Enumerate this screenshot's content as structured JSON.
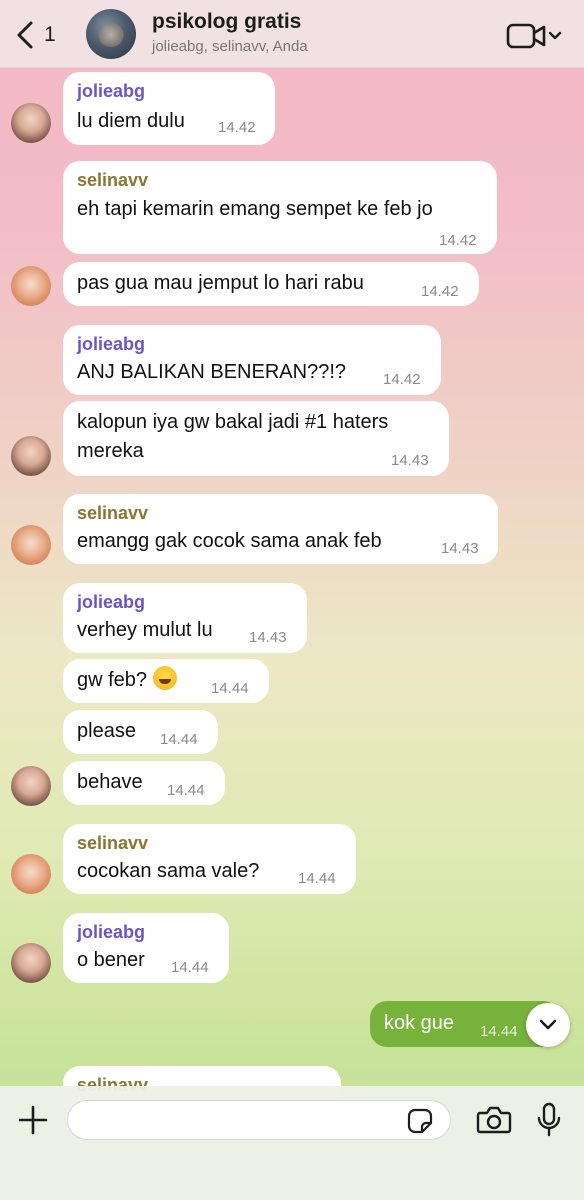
{
  "header": {
    "back_count": "1",
    "group_name": "psikolog gratis",
    "members": "jolieabg, selinavv, Anda"
  },
  "messages": [
    {
      "sender": "jolieabg",
      "text": "lu diem dulu",
      "time": "14.42"
    },
    {
      "sender": "selinavv",
      "text": "eh tapi kemarin emang sempet ke feb jo",
      "time": "14.42"
    },
    {
      "sender": "",
      "text": "pas gua mau jemput lo hari rabu",
      "time": "14.42"
    },
    {
      "sender": "jolieabg",
      "text": "ANJ BALIKAN BENERAN??!?",
      "time": "14.42"
    },
    {
      "sender": "",
      "text_line1": "kalopun iya gw bakal jadi #1 haters",
      "text_line2": "mereka",
      "time": "14.43"
    },
    {
      "sender": "selinavv",
      "text": "emangg gak cocok sama anak feb",
      "time": "14.43"
    },
    {
      "sender": "jolieabg",
      "text": "verhey mulut lu",
      "time": "14.43"
    },
    {
      "sender": "",
      "text": "gw feb?",
      "emoji": "grinning-sweat-emoji",
      "time": "14.44"
    },
    {
      "sender": "",
      "text": "please",
      "time": "14.44"
    },
    {
      "sender": "",
      "text": "behave",
      "time": "14.44"
    },
    {
      "sender": "selinavv",
      "text": "cocokan sama vale?",
      "time": "14.44"
    },
    {
      "sender": "jolieabg",
      "text": "o bener",
      "time": "14.44"
    },
    {
      "sender": "me",
      "text": "kok gue",
      "time": "14.44"
    },
    {
      "sender": "selinavv",
      "text": "",
      "time": ""
    }
  ],
  "composer": {
    "placeholder": ""
  },
  "colors": {
    "outgoing_bubble": "#77b23b",
    "jolie_name": "#6b55c7",
    "selina_name": "#8c7433"
  },
  "icons": [
    "back-chevron-icon",
    "video-call-icon",
    "chevron-down-icon",
    "plus-icon",
    "sticker-icon",
    "camera-icon",
    "microphone-icon"
  ]
}
